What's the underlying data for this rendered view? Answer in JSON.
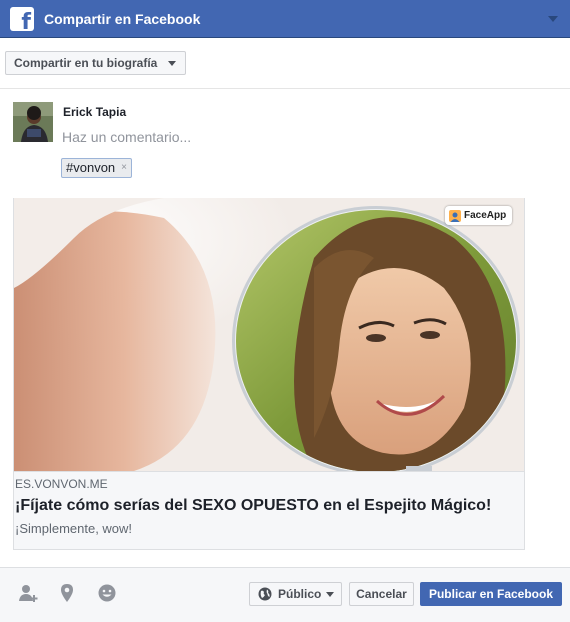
{
  "header": {
    "title": "Compartir en Facebook",
    "logo_icon": "facebook-f-icon",
    "menu_icon": "chevron-down-icon"
  },
  "target": {
    "label": "Compartir en tu biografía"
  },
  "composer": {
    "user_name": "Erick Tapia",
    "comment_placeholder": "Haz un comentario...",
    "comment_value": "",
    "hashtag": "#vonvon",
    "hashtag_remove": "×"
  },
  "preview": {
    "badge": "FaceApp",
    "domain": "ES.VONVON.ME",
    "title": "¡Fíjate cómo serías del SEXO OPUESTO en el Espejito Mágico!",
    "description": "¡Simplemente, wow!"
  },
  "footer": {
    "icons": [
      "tag-friends-icon",
      "location-pin-icon",
      "feeling-emoji-icon"
    ],
    "audience_label": "Público",
    "cancel_label": "Cancelar",
    "publish_label": "Publicar en Facebook"
  },
  "colors": {
    "brand": "#4267b2",
    "brand_dark": "#29487d",
    "panel": "#f6f7f9",
    "text": "#1d2129",
    "muted": "#90949c"
  }
}
